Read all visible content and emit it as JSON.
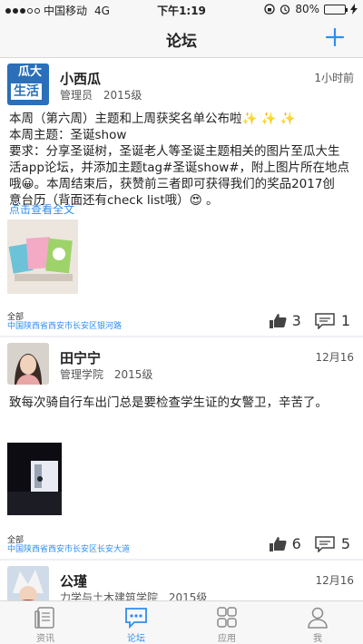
{
  "status_bar": {
    "carrier": "中国移动",
    "network": "4G",
    "time": "下午1:19",
    "battery": "80%",
    "battery_level": 0.8
  },
  "nav": {
    "title": "论坛",
    "add_icon": "plus-icon"
  },
  "posts": [
    {
      "author": "小西瓜",
      "role": "管理员",
      "grade": "2015级",
      "time": "1小时前",
      "avatar_text_top": "瓜大",
      "avatar_text_bottom": "生活",
      "lines": [
        "本周（第六周）主题和上周获奖名单公布啦✨ ✨ ✨",
        "本周主题：圣诞show",
        "要求：分享圣诞树，圣诞老人等圣诞主题相关的图片至瓜大生",
        "活app论坛，并添加主题tag#圣诞show#，附上图片所在地点",
        "哦😀。本周结束后，获赞前三者即可获得我们的奖品2017创",
        "意台历（背面还有check list哦）😍 。"
      ],
      "read_more": "点击查看全文",
      "location_label": "全部",
      "location": "中国陕西省西安市长安区银河路",
      "likes": "3",
      "comments": "1"
    },
    {
      "author": "田宁宁",
      "role": "管理学院",
      "grade": "2015级",
      "time": "12月16",
      "lines": [
        "致每次骑自行车出门总是要检查学生证的女警卫，辛苦了。"
      ],
      "location_label": "全部",
      "location": "中国陕西省西安市长安区长安大道",
      "likes": "6",
      "comments": "5"
    },
    {
      "author": "公瑾",
      "role": "力学与土木建筑学院",
      "grade": "2015级",
      "time": "12月16"
    }
  ],
  "tabs": [
    {
      "label": "资讯",
      "icon": "news-icon"
    },
    {
      "label": "论坛",
      "icon": "forum-icon"
    },
    {
      "label": "应用",
      "icon": "apps-grid-icon"
    },
    {
      "label": "我",
      "icon": "profile-icon"
    }
  ]
}
